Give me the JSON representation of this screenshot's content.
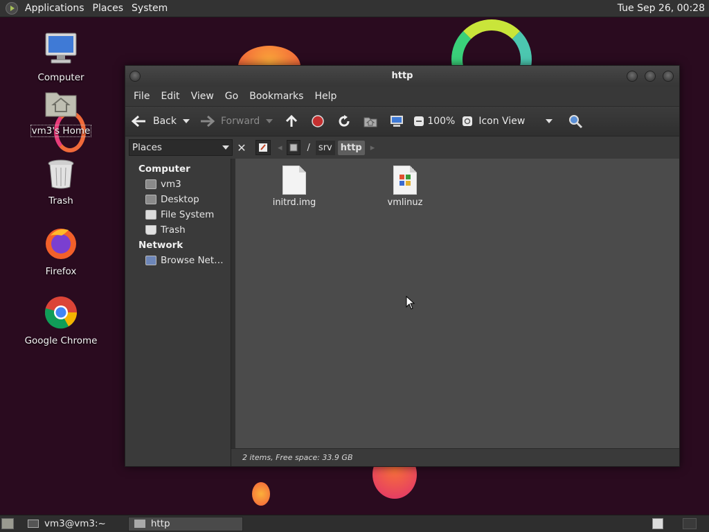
{
  "top_panel": {
    "menus": [
      "Applications",
      "Places",
      "System"
    ],
    "clock": "Tue Sep 26, 00:28"
  },
  "desktop": {
    "icons": [
      {
        "label": "Computer",
        "icon": "computer-icon"
      },
      {
        "label": "vm3's Home",
        "icon": "home-folder-icon"
      },
      {
        "label": "Trash",
        "icon": "trash-icon"
      },
      {
        "label": "Firefox",
        "icon": "firefox-icon"
      },
      {
        "label": "Google Chrome",
        "icon": "chrome-icon"
      }
    ]
  },
  "window": {
    "title": "http",
    "menubar": [
      "File",
      "Edit",
      "View",
      "Go",
      "Bookmarks",
      "Help"
    ],
    "toolbar": {
      "back": "Back",
      "forward": "Forward",
      "zoom": "100%",
      "view_mode": "Icon View"
    },
    "sidebar_selector": "Places",
    "breadcrumbs": [
      "/",
      "srv",
      "http"
    ],
    "sidebar": {
      "sections": [
        {
          "heading": "Computer",
          "items": [
            "vm3",
            "Desktop",
            "File System",
            "Trash"
          ]
        },
        {
          "heading": "Network",
          "items": [
            "Browse Net…"
          ]
        }
      ]
    },
    "files": [
      {
        "name": "initrd.img",
        "icon": "text-file-icon"
      },
      {
        "name": "vmlinuz",
        "icon": "binary-file-icon"
      }
    ],
    "status": "2 items, Free space: 33.9 GB"
  },
  "bottom_panel": {
    "tasks": [
      "vm3@vm3:~",
      "http"
    ]
  },
  "colors": {
    "desktop_bg": "#2a0b1f",
    "window_bg": "#3a3a3a",
    "content_bg": "#4b4b4b",
    "accent_orange": "#f7803a",
    "accent_pink": "#e83c7a"
  }
}
